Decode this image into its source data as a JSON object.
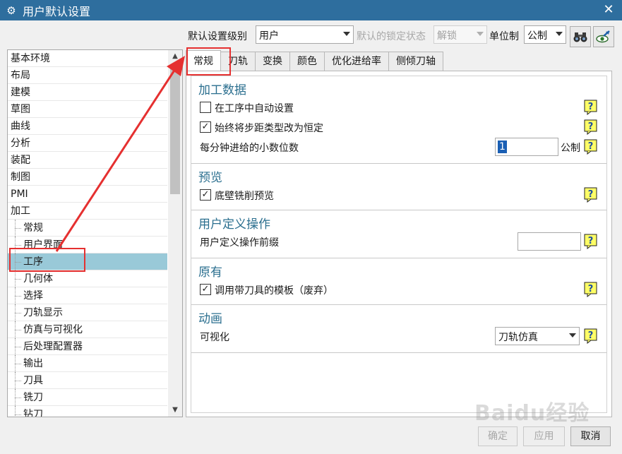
{
  "window": {
    "title": "用户默认设置",
    "gear_icon": "gear-icon",
    "close_icon": "close-icon"
  },
  "toolbar": {
    "level_label": "默认设置级别",
    "level_value": "用户",
    "lock_label": "默认的锁定状态",
    "lock_value": "解锁",
    "unit_label": "单位制",
    "unit_value": "公制"
  },
  "tree": {
    "items": [
      {
        "label": "基本环境"
      },
      {
        "label": "布局"
      },
      {
        "label": "建模"
      },
      {
        "label": "草图"
      },
      {
        "label": "曲线"
      },
      {
        "label": "分析"
      },
      {
        "label": "装配"
      },
      {
        "label": "制图"
      },
      {
        "label": "PMI"
      },
      {
        "label": "加工"
      }
    ],
    "children": [
      {
        "label": "常规"
      },
      {
        "label": "用户界面"
      },
      {
        "label": "工序"
      },
      {
        "label": "几何体"
      },
      {
        "label": "选择"
      },
      {
        "label": "刀轨显示"
      },
      {
        "label": "仿真与可视化"
      },
      {
        "label": "后处理配置器"
      },
      {
        "label": "输出"
      },
      {
        "label": "刀具"
      },
      {
        "label": "铣刀"
      },
      {
        "label": "钻刀"
      }
    ]
  },
  "tabs": [
    {
      "label": "常规"
    },
    {
      "label": "刀轨"
    },
    {
      "label": "变换"
    },
    {
      "label": "颜色"
    },
    {
      "label": "优化进给率"
    },
    {
      "label": "侧倾刀轴"
    }
  ],
  "sections": {
    "data": {
      "title": "加工数据",
      "auto_setup": "在工序中自动设置",
      "step_constant": "始终将步距类型改为恒定",
      "decimal_label": "每分钟进给的小数位数",
      "decimal_value": "1",
      "decimal_unit": "公制"
    },
    "preview": {
      "title": "预览",
      "floor_preview": "底壁铣削预览"
    },
    "user_op": {
      "title": "用户定义操作",
      "prefix_label": "用户定义操作前缀"
    },
    "legacy": {
      "title": "原有",
      "template": "调用带刀具的模板（废弃）"
    },
    "animation": {
      "title": "动画",
      "vis_label": "可视化",
      "vis_value": "刀轨仿真"
    }
  },
  "buttons": {
    "ok": "确定",
    "apply": "应用",
    "cancel": "取消"
  },
  "watermark": "Baidu经验"
}
